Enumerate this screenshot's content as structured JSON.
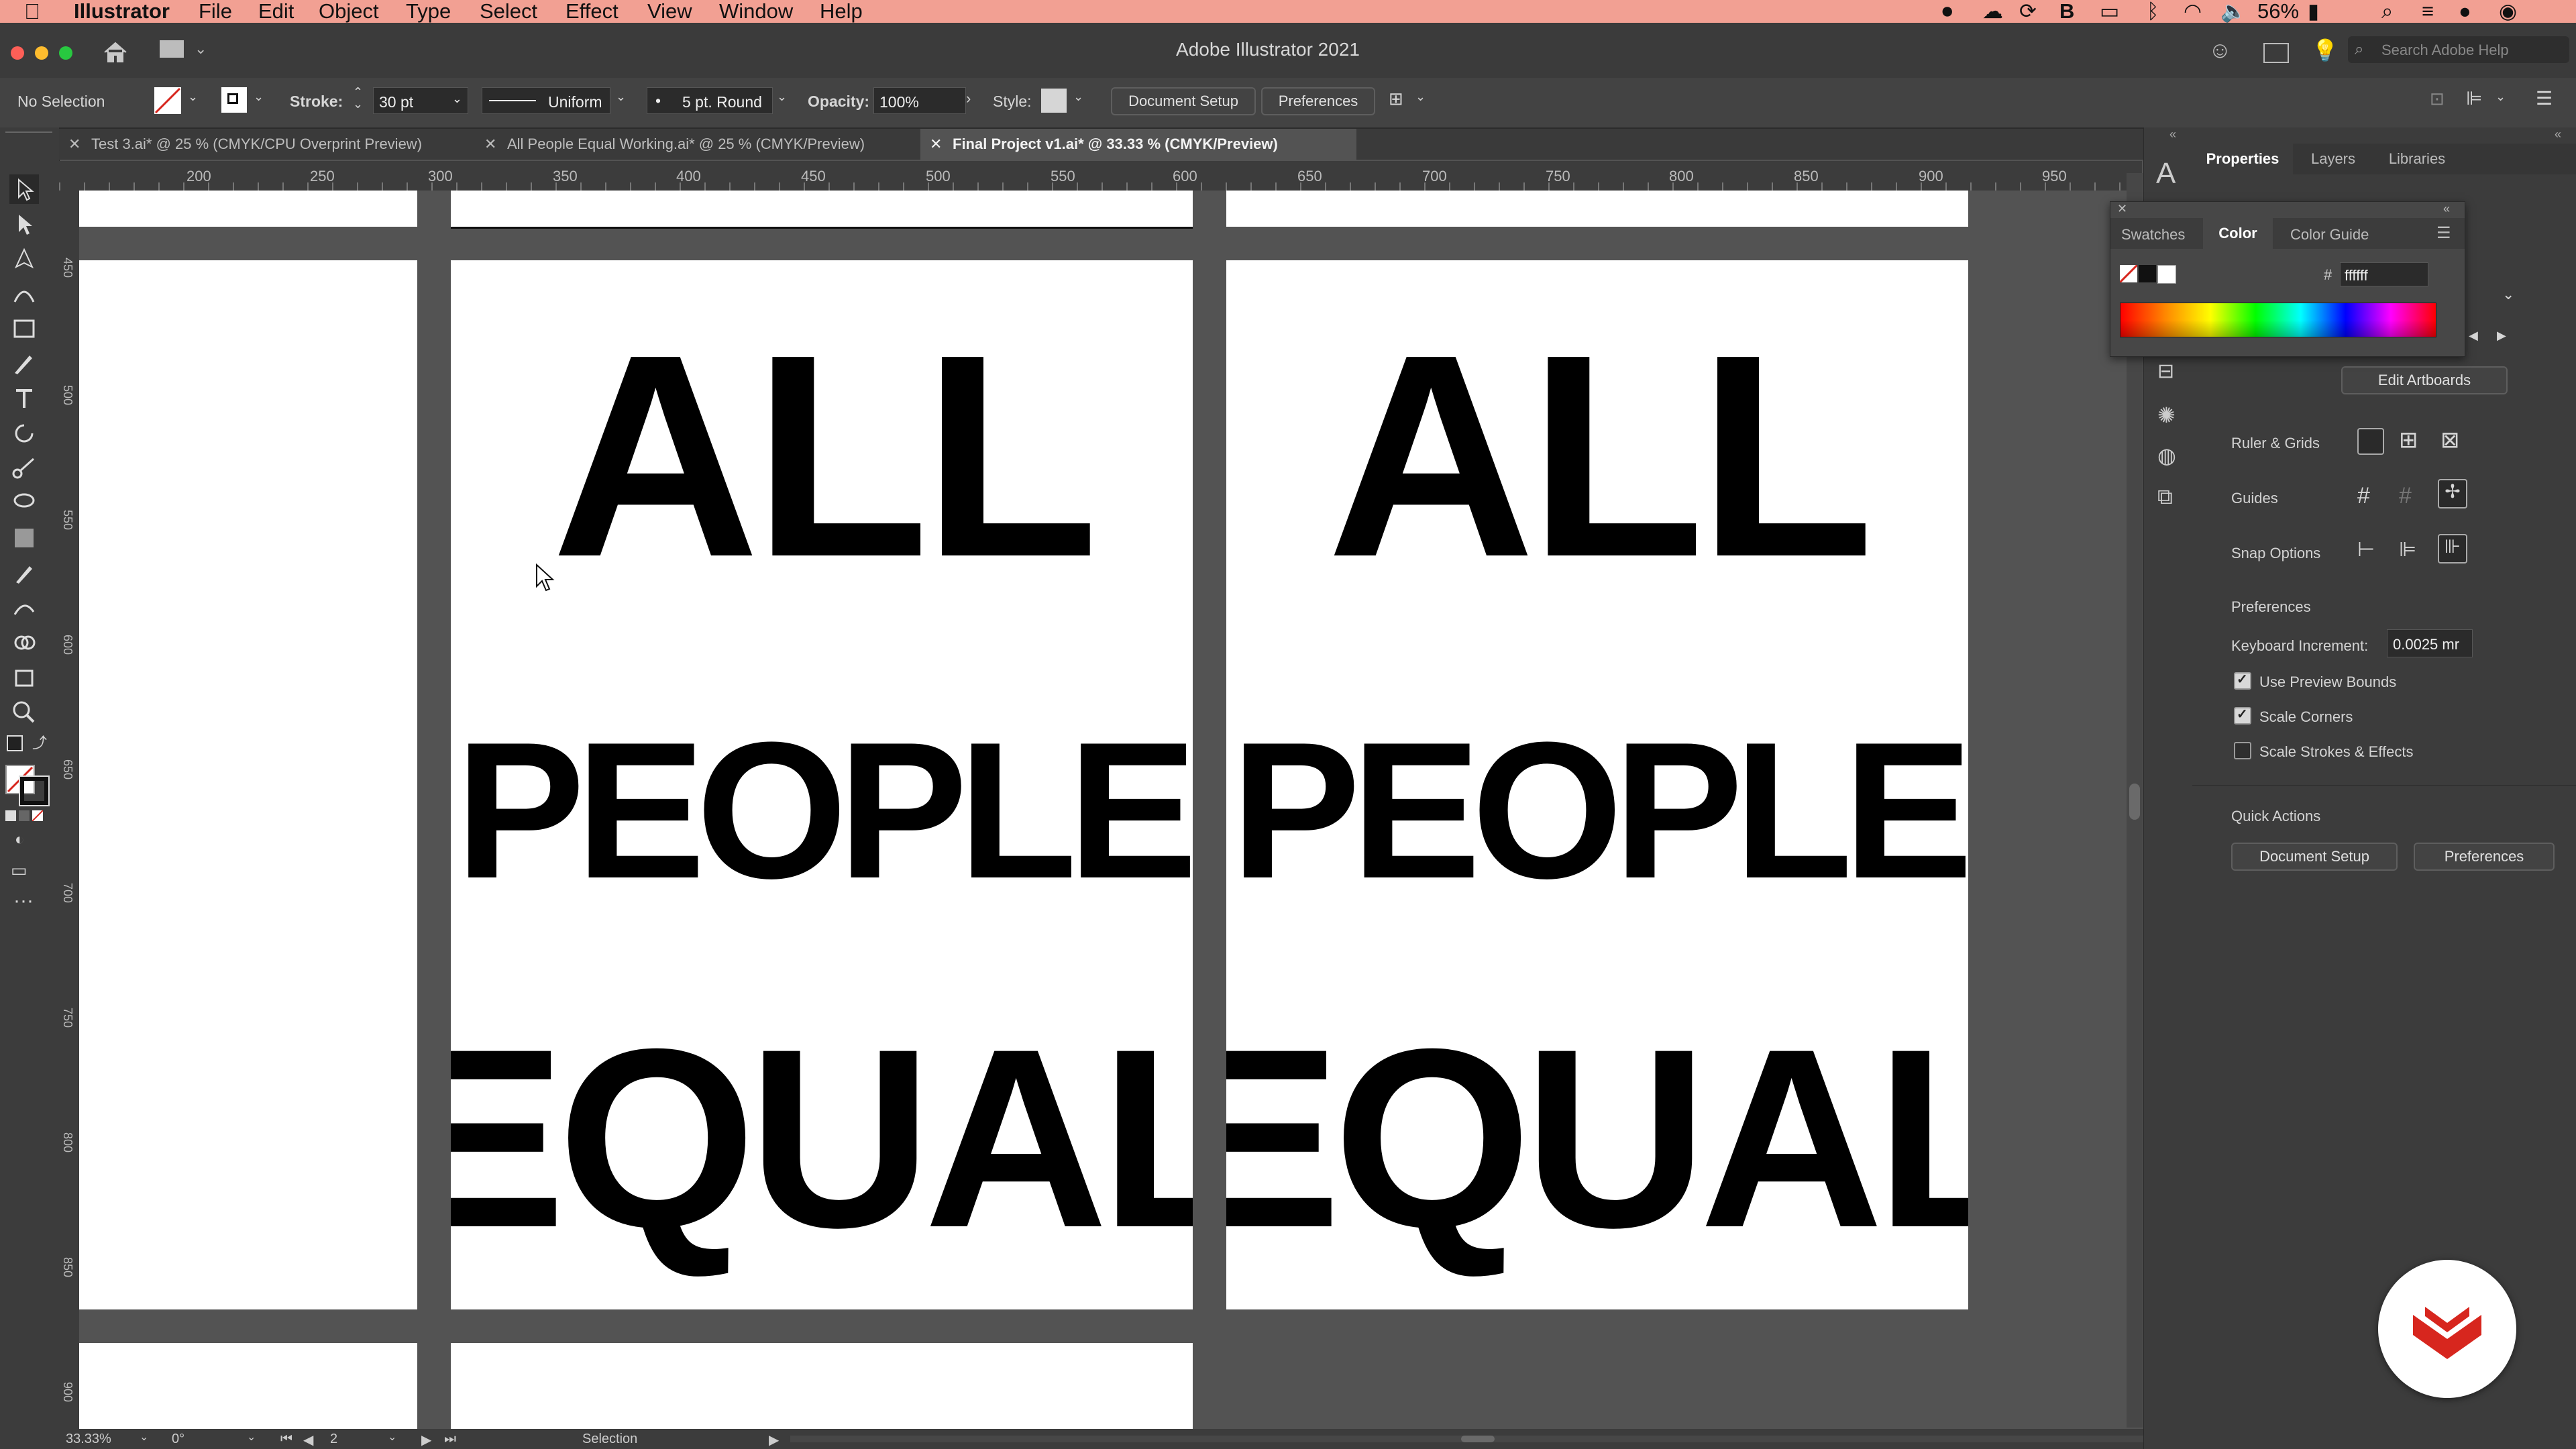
{
  "menubar": {
    "app": "Illustrator",
    "items": [
      "File",
      "Edit",
      "Object",
      "Type",
      "Select",
      "Effect",
      "View",
      "Window",
      "Help"
    ],
    "battery": "56%"
  },
  "window": {
    "title": "Adobe Illustrator 2021",
    "search_placeholder": "Search Adobe Help"
  },
  "control": {
    "selection": "No Selection",
    "stroke_label": "Stroke:",
    "stroke_value": "30 pt",
    "profile": "Uniform",
    "brush": "5 pt. Round",
    "opacity_label": "Opacity:",
    "opacity_value": "100%",
    "style_label": "Style:",
    "document_setup": "Document Setup",
    "preferences": "Preferences"
  },
  "tabs": [
    {
      "label": "Test 3.ai* @ 25 % (CMYK/CPU Overprint Preview)"
    },
    {
      "label": "All People Equal Working.ai* @ 25 % (CMYK/Preview)"
    },
    {
      "label": "Final Project v1.ai* @ 33.33 % (CMYK/Preview)"
    }
  ],
  "ruler": {
    "top": [
      "200",
      "250",
      "300",
      "350",
      "400",
      "450",
      "500",
      "550",
      "600",
      "650",
      "700",
      "750",
      "800",
      "850",
      "900",
      "950"
    ],
    "left": [
      "450",
      "500",
      "550",
      "600",
      "650",
      "700",
      "750",
      "800",
      "850",
      "900"
    ]
  },
  "artwork": {
    "lines": [
      "ALL",
      "PEOPLE",
      "EQUAL"
    ]
  },
  "color_panel": {
    "tabs": [
      "Swatches",
      "Color",
      "Color Guide"
    ],
    "hex_symbol": "#",
    "hex": "ffffff"
  },
  "properties": {
    "tabs": [
      "Properties",
      "Layers",
      "Libraries"
    ],
    "edit_artboards": "Edit Artboards",
    "ruler_grids": "Ruler & Grids",
    "guides": "Guides",
    "snap_options": "Snap Options",
    "preferences_heading": "Preferences",
    "keyboard_increment_label": "Keyboard Increment:",
    "keyboard_increment_value": "0.0025 mr",
    "use_preview_bounds": "Use Preview Bounds",
    "scale_corners": "Scale Corners",
    "scale_strokes": "Scale Strokes & Effects",
    "quick_actions": "Quick Actions",
    "qa_document_setup": "Document Setup",
    "qa_preferences": "Preferences"
  },
  "status": {
    "zoom": "33.33%",
    "rotation": "0°",
    "artboard": "2",
    "tool": "Selection"
  },
  "colors": {
    "menubar": "#f2a093",
    "accent_red": "#d7261e"
  }
}
